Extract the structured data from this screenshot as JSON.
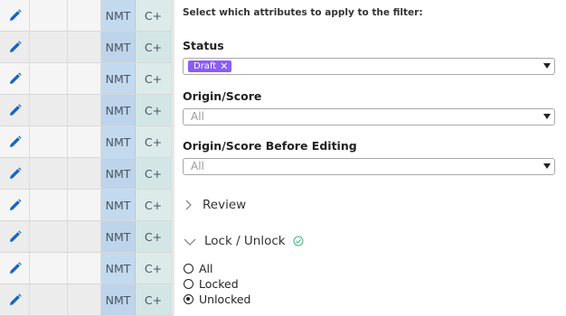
{
  "grid": {
    "rows": [
      {
        "engine": "NMT",
        "flag": "C+"
      },
      {
        "engine": "NMT",
        "flag": "C+"
      },
      {
        "engine": "NMT",
        "flag": "C+"
      },
      {
        "engine": "NMT",
        "flag": "C+"
      },
      {
        "engine": "NMT",
        "flag": "C+"
      },
      {
        "engine": "NMT",
        "flag": "C+"
      },
      {
        "engine": "NMT",
        "flag": "C+"
      },
      {
        "engine": "NMT",
        "flag": "C+"
      },
      {
        "engine": "NMT",
        "flag": "C+"
      },
      {
        "engine": "NMT",
        "flag": "C+"
      }
    ],
    "edit_icon": "pencil-icon",
    "colors": {
      "nmt_bg": "#c3d9ee",
      "cp_bg": "#dcebea",
      "pencil": "#1565c0"
    }
  },
  "filter": {
    "instruction": "Select which attributes to apply to the filter:",
    "status": {
      "label": "Status",
      "selected_chip": "Draft",
      "chip_color": "#8b5cf6"
    },
    "origin_score": {
      "label": "Origin/Score",
      "placeholder": "All"
    },
    "origin_score_before": {
      "label": "Origin/Score Before Editing",
      "placeholder": "All"
    },
    "review": {
      "label": "Review",
      "expanded": false
    },
    "lock": {
      "label": "Lock / Unlock",
      "expanded": true,
      "active_indicator_color": "#3ab77a",
      "options": [
        {
          "label": "All",
          "checked": false
        },
        {
          "label": "Locked",
          "checked": false
        },
        {
          "label": "Unlocked",
          "checked": true
        }
      ]
    }
  }
}
